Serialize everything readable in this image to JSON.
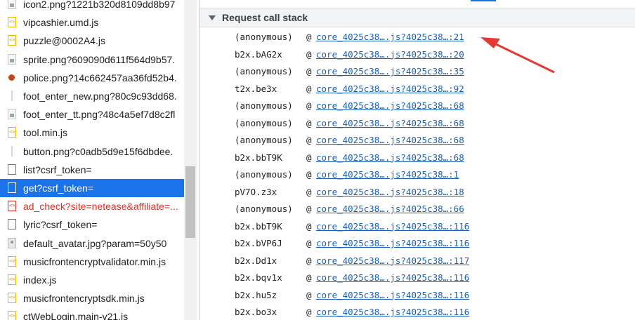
{
  "network_list": {
    "items": [
      {
        "name": "icon2.png?1221b320d8109dd8b97",
        "icon": "image-icon",
        "state": "normal"
      },
      {
        "name": "vipcashier.umd.js",
        "icon": "script-icon",
        "state": "normal"
      },
      {
        "name": "puzzle@0002A4.js",
        "icon": "script-icon",
        "state": "normal"
      },
      {
        "name": "sprite.png?609090d611f564d9b57.",
        "icon": "image-icon",
        "state": "normal"
      },
      {
        "name": "police.png?14c662457aa36fd52b4.",
        "icon": "police-image-icon",
        "state": "normal"
      },
      {
        "name": "foot_enter_new.png?80c9c93dd68.",
        "icon": "thin-image-icon",
        "state": "normal"
      },
      {
        "name": "foot_enter_tt.png?48c4a5ef7d8c2fl",
        "icon": "image-icon",
        "state": "normal"
      },
      {
        "name": "tool.min.js",
        "icon": "script-icon",
        "state": "normal"
      },
      {
        "name": "button.png?c0adb5d9e15f6dbdee.",
        "icon": "thin-image-icon",
        "state": "normal"
      },
      {
        "name": "list?csrf_token=",
        "icon": "document-icon",
        "state": "normal"
      },
      {
        "name": "get?csrf_token=",
        "icon": "document-icon",
        "state": "selected"
      },
      {
        "name": "ad_check?site=netease&affiliate=...",
        "icon": "error-script-icon",
        "state": "error"
      },
      {
        "name": "lyric?csrf_token=",
        "icon": "document-icon",
        "state": "normal"
      },
      {
        "name": "default_avatar.jpg?param=50y50",
        "icon": "avatar-image-icon",
        "state": "normal"
      },
      {
        "name": "musicfrontencryptvalidator.min.js",
        "icon": "script-icon",
        "state": "normal"
      },
      {
        "name": "index.js",
        "icon": "script-icon",
        "state": "normal"
      },
      {
        "name": "musicfrontencryptsdk.min.js",
        "icon": "script-icon",
        "state": "normal"
      },
      {
        "name": "ctWebLogin.main-v21.js",
        "icon": "script-icon",
        "state": "normal"
      }
    ]
  },
  "initiator": {
    "section_title": "Request call stack",
    "frames": [
      {
        "fn": "(anonymous)",
        "at": "@",
        "loc": "core_4025c38….js?4025c38…:21"
      },
      {
        "fn": "b2x.bAG2x",
        "at": "@",
        "loc": "core_4025c38….js?4025c38…:20"
      },
      {
        "fn": "(anonymous)",
        "at": "@",
        "loc": "core_4025c38….js?4025c38…:35"
      },
      {
        "fn": "t2x.be3x",
        "at": "@",
        "loc": "core_4025c38….js?4025c38…:92"
      },
      {
        "fn": "(anonymous)",
        "at": "@",
        "loc": "core_4025c38….js?4025c38…:68"
      },
      {
        "fn": "(anonymous)",
        "at": "@",
        "loc": "core_4025c38….js?4025c38…:68"
      },
      {
        "fn": "(anonymous)",
        "at": "@",
        "loc": "core_4025c38….js?4025c38…:68"
      },
      {
        "fn": "b2x.bbT9K",
        "at": "@",
        "loc": "core_4025c38….js?4025c38…:68"
      },
      {
        "fn": "(anonymous)",
        "at": "@",
        "loc": "core_4025c38….js?4025c38…:1"
      },
      {
        "fn": "pV7O.z3x",
        "at": "@",
        "loc": "core_4025c38….js?4025c38…:18"
      },
      {
        "fn": "(anonymous)",
        "at": "@",
        "loc": "core_4025c38….js?4025c38…:66"
      },
      {
        "fn": "b2x.bbT9K",
        "at": "@",
        "loc": "core_4025c38….js?4025c38…:116"
      },
      {
        "fn": "b2x.bVP6J",
        "at": "@",
        "loc": "core_4025c38….js?4025c38…:116"
      },
      {
        "fn": "b2x.Dd1x",
        "at": "@",
        "loc": "core_4025c38….js?4025c38…:117"
      },
      {
        "fn": "b2x.bqv1x",
        "at": "@",
        "loc": "core_4025c38….js?4025c38…:116"
      },
      {
        "fn": "b2x.hu5z",
        "at": "@",
        "loc": "core_4025c38….js?4025c38…:116"
      },
      {
        "fn": "b2x.bo3x",
        "at": "@",
        "loc": "core_4025c38….js?4025c38…:116"
      }
    ]
  },
  "annotation": {
    "color": "#e53935",
    "icon": "red-arrow-icon"
  },
  "colors": {
    "selected": "#1a73e8",
    "link": "#1a5fb4",
    "error": "#d93025"
  }
}
